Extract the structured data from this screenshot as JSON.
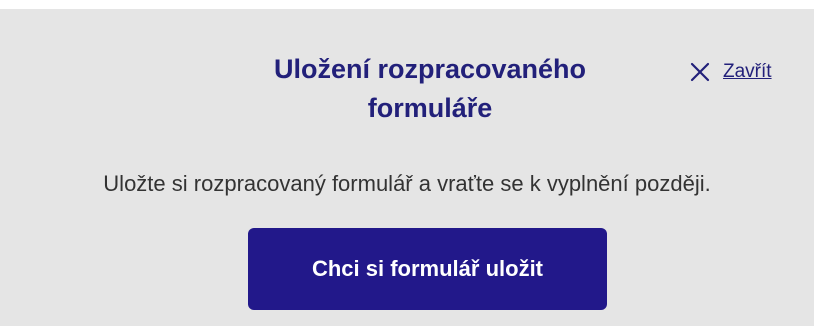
{
  "dialog": {
    "title_line1": "Uložení rozpracovaného",
    "title_line2": "formuláře",
    "close_label": "Zavřít",
    "close_icon": "close-icon",
    "description": "Uložte si rozpracovaný formulář a vraťte se k vyplnění později.",
    "save_button_label": "Chci si formulář uložit"
  },
  "colors": {
    "background": "#e5e5e5",
    "accent": "#22188a",
    "title": "#22207a",
    "text": "#333333"
  }
}
